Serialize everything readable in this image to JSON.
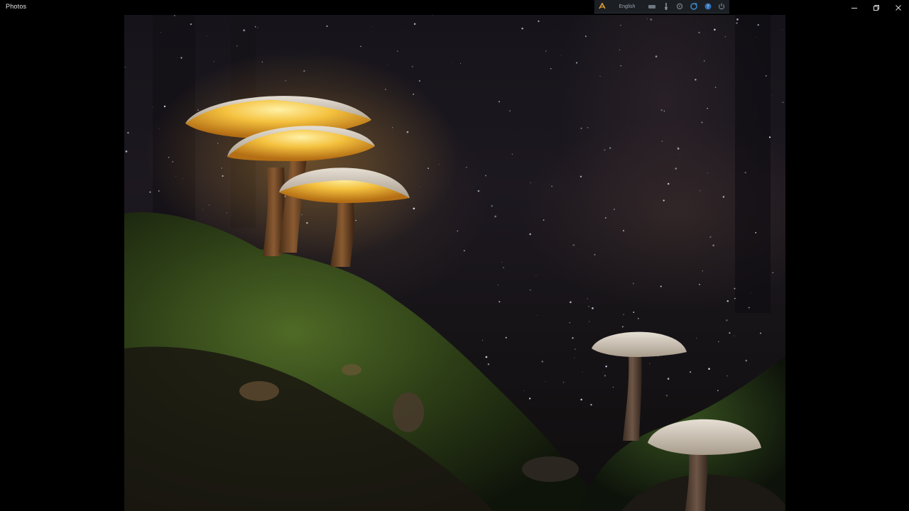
{
  "window": {
    "title": "Photos",
    "controls": {
      "minimize_icon": "minimize-icon",
      "restore_icon": "restore-icon",
      "close_icon": "close-icon"
    }
  },
  "overlay_toolbar": {
    "language": "English",
    "icons": [
      "translator-logo-icon",
      "keyboard-icon",
      "brush-icon",
      "settings-icon",
      "refresh-icon",
      "help-icon",
      "power-icon"
    ]
  },
  "photo": {
    "subject": "glowing-mushrooms-photo"
  },
  "colors": {
    "background": "#000000",
    "title_text": "#e6e6e6",
    "glow": "#f2b233"
  }
}
